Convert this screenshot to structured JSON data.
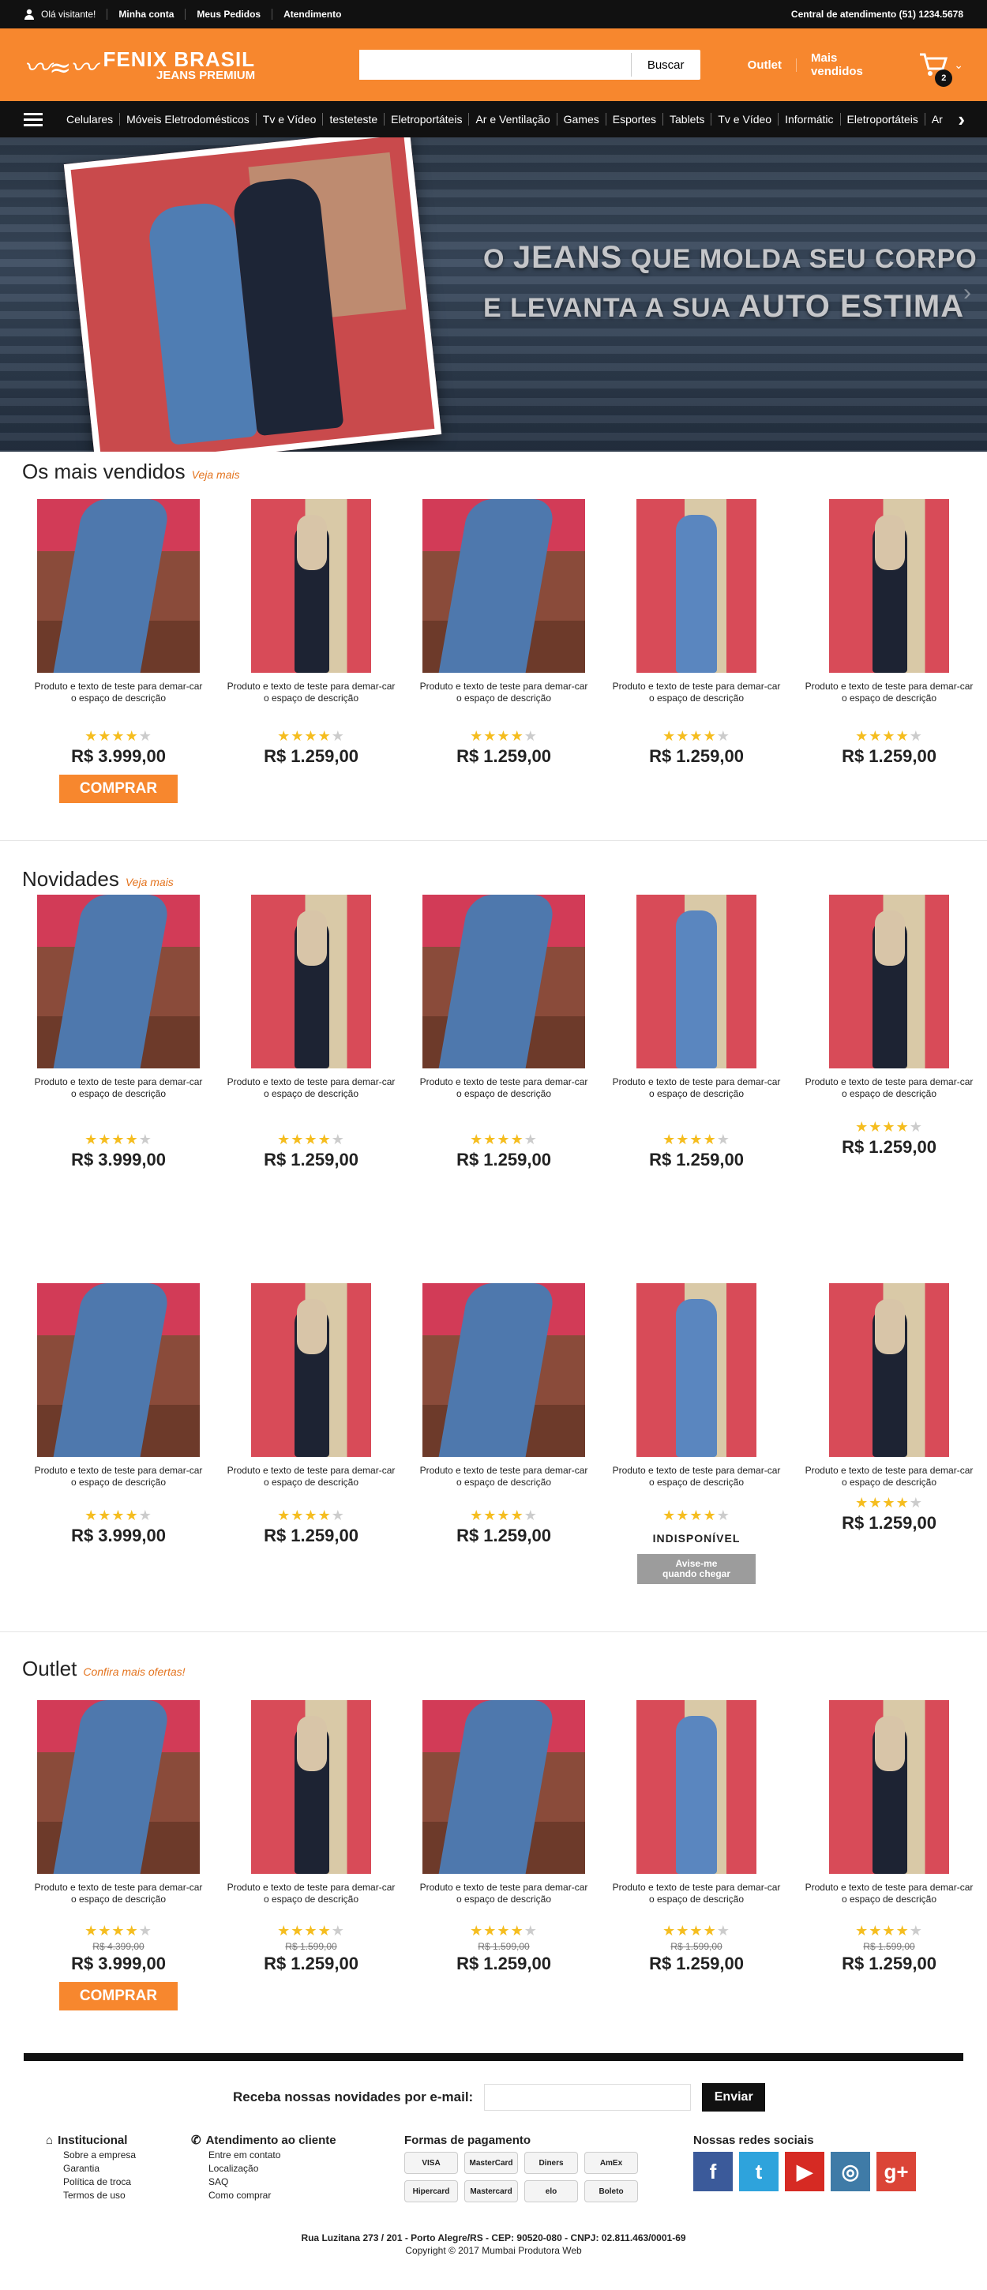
{
  "topbar": {
    "greeting": "Olá visitante!",
    "links": [
      "Minha conta",
      "Meus Pedidos",
      "Atendimento"
    ],
    "central": "Central de atendimento (51) 1234.5678"
  },
  "header": {
    "logo_line1": "FENIX BRASIL",
    "logo_line2": "JEANS PREMIUM",
    "search_button": "Buscar",
    "links": [
      "Outlet",
      "Mais vendidos"
    ],
    "cart_count": "2"
  },
  "nav": {
    "categories": [
      "Celulares",
      "Móveis Eletrodomésticos",
      "Tv e Vídeo",
      "testeteste",
      "Eletroportáteis",
      "Ar e Ventilação",
      "Games",
      "Esportes",
      "Tablets",
      "Tv e Vídeo",
      "Informátic",
      "Eletroportáteis",
      "Ar"
    ]
  },
  "banner": {
    "line1a": "O ",
    "line1b": "JEANS",
    "line1c": " QUE MOLDA SEU CORPO",
    "line2a": "E LEVANTA A SUA ",
    "line2b": "AUTO ESTIMA"
  },
  "sections": {
    "mais_vendidos": {
      "title": "Os mais vendidos",
      "more": "Veja mais"
    },
    "novidades": {
      "title": "Novidades",
      "more": "Veja mais"
    },
    "outlet": {
      "title": "Outlet",
      "more": "Confira mais ofertas!"
    }
  },
  "product": {
    "desc": "Produto e texto de teste para demar-car o espaço de descrição",
    "price_a": "R$ 3.999,00",
    "price_b": "R$ 1.259,00",
    "old_a": "R$ 4.399,00",
    "old_b": "R$ 1.599,00",
    "buy": "COMPRAR",
    "unavailable": "INDISPONÍVEL",
    "notify_line1": "Avise-me",
    "notify_line2": "quando chegar",
    "rating": 4
  },
  "footer": {
    "newsletter_label": "Receba nossas novidades por e-mail:",
    "newsletter_button": "Enviar",
    "institucional": {
      "title": "Institucional",
      "links": [
        "Sobre a empresa",
        "Garantia",
        "Política de troca",
        "Termos de uso"
      ]
    },
    "atendimento": {
      "title": "Atendimento ao cliente",
      "links": [
        "Entre em contato",
        "Localização",
        "SAQ",
        "Como comprar"
      ]
    },
    "pagamento": {
      "title": "Formas de pagamento",
      "methods": [
        "VISA",
        "MasterCard",
        "Diners",
        "AmEx",
        "Hipercard",
        "Mastercard",
        "elo",
        "Boleto"
      ]
    },
    "sociais": {
      "title": "Nossas redes sociais",
      "networks": [
        {
          "name": "Facebook",
          "glyph": "f",
          "color": "#3b5a9a"
        },
        {
          "name": "Twitter",
          "glyph": "t",
          "color": "#2ea3dc"
        },
        {
          "name": "YouTube",
          "glyph": "▶",
          "color": "#d62a23"
        },
        {
          "name": "Instagram",
          "glyph": "◎",
          "color": "#3f7ba7"
        },
        {
          "name": "Google Plus",
          "glyph": "g+",
          "color": "#db4437"
        }
      ]
    },
    "address": "Rua Luzitana 273 / 201 - Porto Alegre/RS - CEP: 90520-080 - CNPJ: 02.811.463/0001-69",
    "copyright": "Copyright © 2017 Mumbai Produtora Web"
  }
}
